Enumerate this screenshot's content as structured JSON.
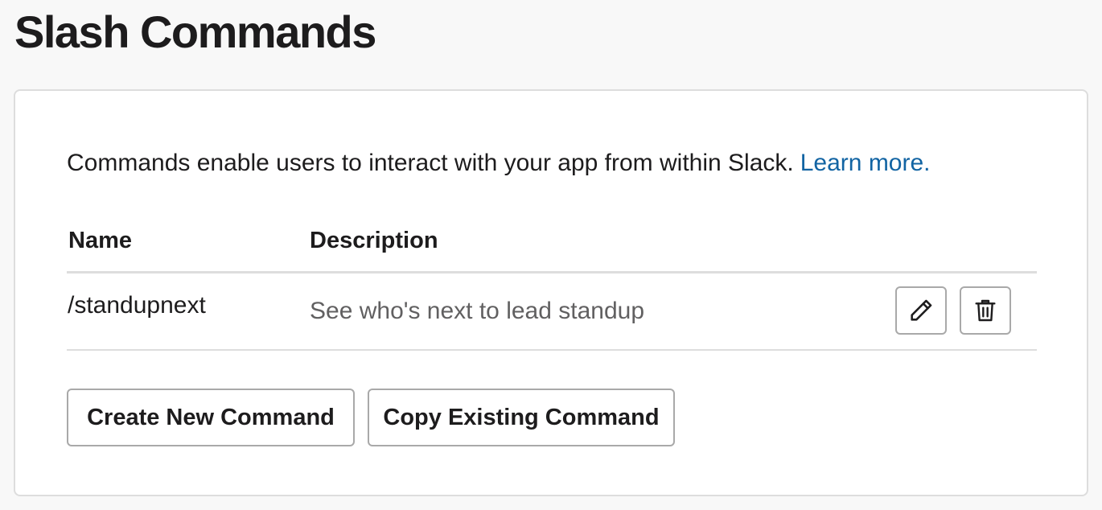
{
  "page": {
    "title": "Slash Commands"
  },
  "intro": {
    "text": "Commands enable users to interact with your app from within Slack.",
    "link_label": "Learn more."
  },
  "table": {
    "headers": {
      "name": "Name",
      "description": "Description"
    },
    "rows": [
      {
        "name": "/standupnext",
        "description": "See who's next to lead standup"
      }
    ],
    "row_actions": {
      "edit_icon": "pencil-icon",
      "delete_icon": "trash-icon"
    }
  },
  "actions": {
    "create_label": "Create New Command",
    "copy_label": "Copy Existing Command"
  },
  "colors": {
    "link": "#1264a3",
    "text": "#1d1c1d",
    "muted_text": "#616061",
    "border": "#dddddd",
    "button_border": "#a9a9a9",
    "page_background": "#f8f8f8"
  }
}
